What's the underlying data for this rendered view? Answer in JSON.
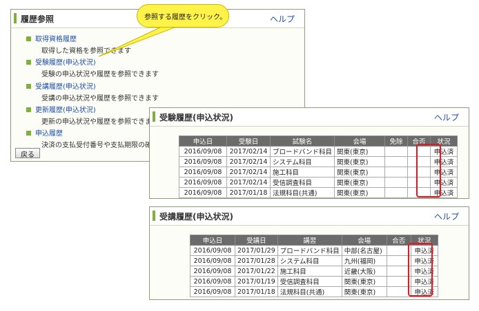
{
  "history_panel": {
    "title": "履歴参照",
    "help": "ヘルプ",
    "items": [
      {
        "link": "取得資格履歴",
        "desc": "取得した資格を参照できます"
      },
      {
        "link": "受験履歴(申込状況)",
        "desc": "受験の申込状況や履歴を参照できます"
      },
      {
        "link": "受講履歴(申込状況)",
        "desc": "受講の申込状況や履歴を参照できます"
      },
      {
        "link": "更新履歴(申込状況)",
        "desc": "更新の申込状況や履歴を参照できます"
      },
      {
        "link": "申込履歴",
        "desc": "決済の支払受付番号や支払期限の確認"
      }
    ],
    "back_button": "戻る"
  },
  "callout": {
    "text": "参照する履歴をクリック。"
  },
  "exam_panel": {
    "title": "受験履歴(申込状況)",
    "help": "ヘルプ",
    "headers": [
      "申込日",
      "受験日",
      "試験名",
      "会場",
      "免除",
      "合否",
      "状況"
    ],
    "rows": [
      [
        "2016/09/08",
        "2017/02/14",
        "ブロードバンド科目",
        "関東(東京)",
        "",
        "",
        "申込済"
      ],
      [
        "2016/09/08",
        "2017/02/14",
        "システム科目",
        "関東(東京)",
        "",
        "",
        "申込済"
      ],
      [
        "2016/09/08",
        "2017/02/14",
        "施工科目",
        "関東(東京)",
        "",
        "",
        "申込済"
      ],
      [
        "2016/09/08",
        "2017/02/14",
        "受信調査科目",
        "関東(東京)",
        "",
        "",
        "申込済"
      ],
      [
        "2016/09/08",
        "2017/01/18",
        "法規科目(共通)",
        "関東(東京)",
        "",
        "",
        "申込済"
      ]
    ]
  },
  "course_panel": {
    "title": "受講履歴(申込状況)",
    "help": "ヘルプ",
    "headers": [
      "申込日",
      "受講日",
      "講習",
      "会場",
      "合否",
      "状況"
    ],
    "rows": [
      [
        "2016/09/08",
        "2017/01/29",
        "ブロードバンド科目",
        "中部(名古屋)",
        "",
        "申込済"
      ],
      [
        "2016/09/08",
        "2017/01/28",
        "システム科目",
        "九州(福岡)",
        "",
        "申込済"
      ],
      [
        "2016/09/08",
        "2017/01/22",
        "施工科目",
        "近畿(大阪)",
        "",
        "申込済"
      ],
      [
        "2016/09/08",
        "2017/01/19",
        "受信調査科目",
        "関東(東京)",
        "",
        "申込済"
      ],
      [
        "2016/09/08",
        "2017/01/18",
        "法規科目(共通)",
        "関東(東京)",
        "",
        "申込済"
      ]
    ]
  },
  "colors": {
    "accent": "#7fb13a",
    "link": "#1f4ea8",
    "highlight": "#e8141e",
    "callout": "#fff34a"
  }
}
